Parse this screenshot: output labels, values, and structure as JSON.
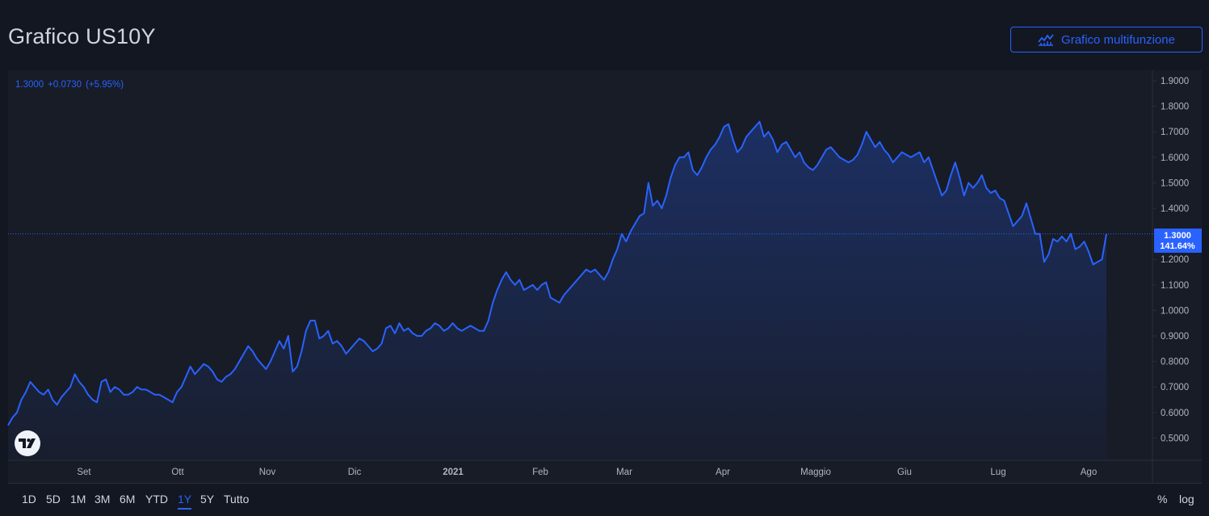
{
  "header": {
    "title": "Grafico US10Y",
    "multi_button_label": "Grafico multifunzione",
    "multi_button_icon": "chart-line-icon"
  },
  "legend": {
    "last": "1.3000",
    "change": "+0.0730",
    "change_pct": "(+5.95%)"
  },
  "price_label": {
    "value": "1.3000",
    "percent": "141.64%"
  },
  "bottom_bar": {
    "ranges": [
      "1D",
      "5D",
      "1M",
      "3M",
      "6M",
      "YTD",
      "1Y",
      "5Y",
      "Tutto"
    ],
    "active_range": "1Y",
    "percent_toggle": "%",
    "log_toggle": "log"
  },
  "colors": {
    "line": "#2962ff",
    "background": "#131722",
    "panel": "#181c27",
    "text": "#d1d4dc"
  },
  "chart_data": {
    "type": "area",
    "title": "",
    "xlabel": "",
    "ylabel": "",
    "ylim": [
      0.4,
      1.95
    ],
    "y_ticks": [
      "1.9000",
      "1.8000",
      "1.7000",
      "1.6000",
      "1.5000",
      "1.4000",
      "1.3000",
      "1.2000",
      "1.1000",
      "1.0000",
      "0.9000",
      "0.8000",
      "0.7000",
      "0.6000",
      "0.5000"
    ],
    "x_ticks": [
      "Set",
      "Ott",
      "Nov",
      "Dic",
      "2021",
      "Feb",
      "Mar",
      "Apr",
      "Maggio",
      "Giu",
      "Lug",
      "Ago"
    ],
    "last_value": 1.3,
    "grid": false,
    "series": [
      {
        "values": [
          0.55,
          0.58,
          0.6,
          0.65,
          0.68,
          0.72,
          0.7,
          0.68,
          0.67,
          0.69,
          0.65,
          0.63,
          0.66,
          0.68,
          0.7,
          0.75,
          0.72,
          0.7,
          0.67,
          0.65,
          0.64,
          0.72,
          0.73,
          0.68,
          0.7,
          0.69,
          0.67,
          0.67,
          0.68,
          0.7,
          0.69,
          0.69,
          0.68,
          0.67,
          0.67,
          0.66,
          0.65,
          0.64,
          0.68,
          0.7,
          0.74,
          0.78,
          0.75,
          0.77,
          0.79,
          0.78,
          0.76,
          0.73,
          0.72,
          0.74,
          0.75,
          0.77,
          0.8,
          0.83,
          0.86,
          0.84,
          0.81,
          0.79,
          0.77,
          0.8,
          0.84,
          0.88,
          0.85,
          0.9,
          0.76,
          0.78,
          0.84,
          0.92,
          0.96,
          0.96,
          0.89,
          0.9,
          0.92,
          0.87,
          0.88,
          0.86,
          0.83,
          0.85,
          0.87,
          0.89,
          0.88,
          0.86,
          0.84,
          0.85,
          0.87,
          0.93,
          0.94,
          0.91,
          0.95,
          0.92,
          0.93,
          0.91,
          0.9,
          0.9,
          0.92,
          0.93,
          0.95,
          0.94,
          0.92,
          0.93,
          0.95,
          0.93,
          0.92,
          0.93,
          0.94,
          0.93,
          0.92,
          0.92,
          0.96,
          1.03,
          1.08,
          1.12,
          1.15,
          1.12,
          1.1,
          1.12,
          1.08,
          1.09,
          1.1,
          1.08,
          1.1,
          1.11,
          1.05,
          1.04,
          1.03,
          1.06,
          1.08,
          1.1,
          1.12,
          1.14,
          1.16,
          1.15,
          1.16,
          1.14,
          1.12,
          1.15,
          1.2,
          1.24,
          1.3,
          1.27,
          1.31,
          1.34,
          1.37,
          1.38,
          1.5,
          1.41,
          1.43,
          1.4,
          1.45,
          1.52,
          1.57,
          1.6,
          1.6,
          1.62,
          1.55,
          1.53,
          1.56,
          1.6,
          1.63,
          1.65,
          1.68,
          1.72,
          1.73,
          1.67,
          1.62,
          1.64,
          1.68,
          1.7,
          1.72,
          1.74,
          1.68,
          1.7,
          1.67,
          1.62,
          1.65,
          1.66,
          1.63,
          1.6,
          1.62,
          1.58,
          1.56,
          1.55,
          1.57,
          1.6,
          1.63,
          1.64,
          1.62,
          1.6,
          1.59,
          1.58,
          1.59,
          1.61,
          1.65,
          1.7,
          1.67,
          1.64,
          1.66,
          1.63,
          1.61,
          1.58,
          1.6,
          1.62,
          1.61,
          1.6,
          1.61,
          1.62,
          1.58,
          1.6,
          1.55,
          1.5,
          1.45,
          1.47,
          1.53,
          1.58,
          1.52,
          1.45,
          1.5,
          1.48,
          1.5,
          1.53,
          1.48,
          1.46,
          1.47,
          1.44,
          1.43,
          1.38,
          1.33,
          1.35,
          1.37,
          1.42,
          1.36,
          1.3,
          1.3,
          1.19,
          1.22,
          1.28,
          1.27,
          1.29,
          1.27,
          1.3,
          1.24,
          1.25,
          1.27,
          1.23,
          1.18,
          1.19,
          1.2,
          1.3
        ]
      }
    ]
  }
}
